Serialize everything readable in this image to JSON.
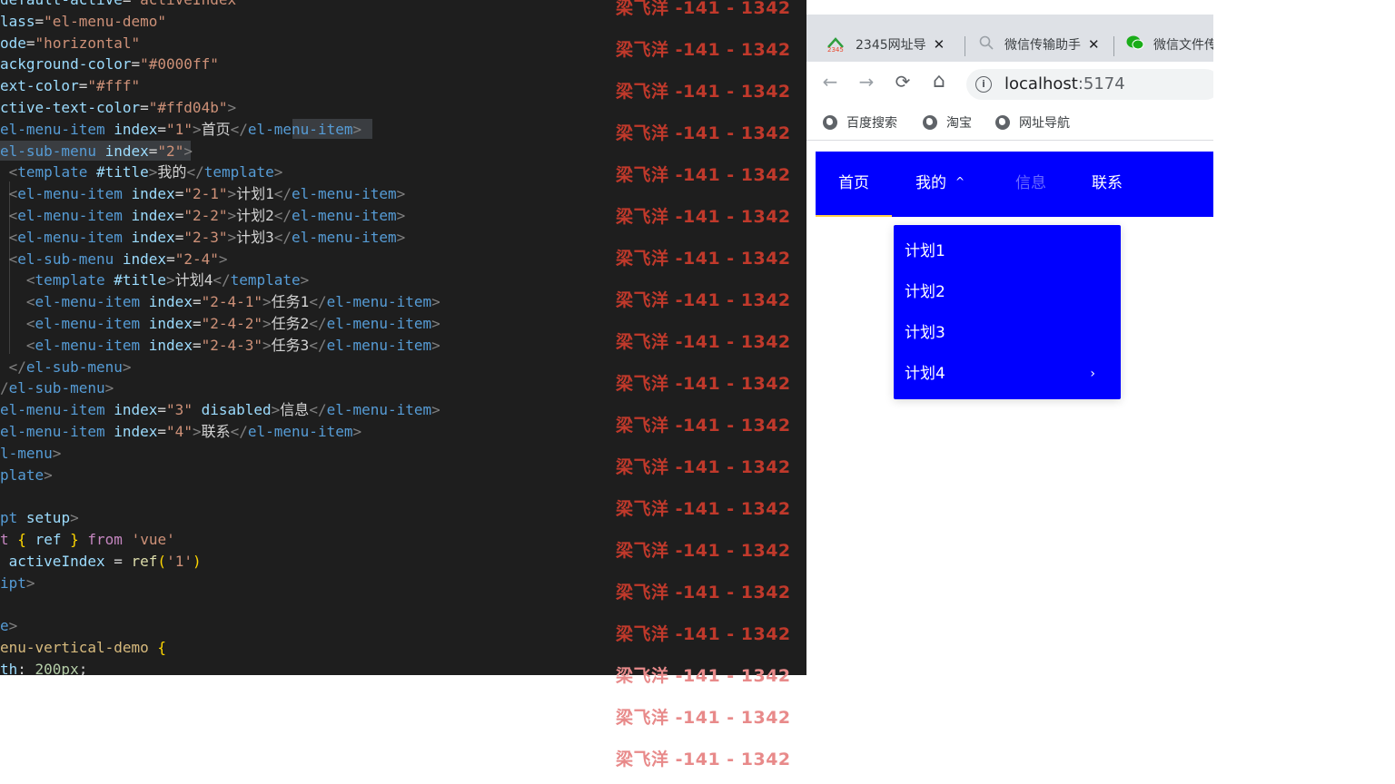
{
  "editor": {
    "lines": [
      [
        {
          "c": "t-attr",
          "t": "default-active"
        },
        {
          "c": "t-txt",
          "t": "="
        },
        {
          "c": "t-str",
          "t": "\"activeIndex\""
        }
      ],
      [
        {
          "c": "t-attr",
          "t": "lass"
        },
        {
          "c": "t-txt",
          "t": "="
        },
        {
          "c": "t-str",
          "t": "\"el-menu-demo\""
        }
      ],
      [
        {
          "c": "t-attr",
          "t": "ode"
        },
        {
          "c": "t-txt",
          "t": "="
        },
        {
          "c": "t-str",
          "t": "\"horizontal\""
        }
      ],
      [
        {
          "c": "t-attr",
          "t": "ackground-color"
        },
        {
          "c": "t-txt",
          "t": "="
        },
        {
          "c": "t-str",
          "t": "\"#0000ff\""
        }
      ],
      [
        {
          "c": "t-attr",
          "t": "ext-color"
        },
        {
          "c": "t-txt",
          "t": "="
        },
        {
          "c": "t-str",
          "t": "\"#fff\""
        }
      ],
      [
        {
          "c": "t-attr",
          "t": "ctive-text-color"
        },
        {
          "c": "t-txt",
          "t": "="
        },
        {
          "c": "t-str",
          "t": "\"#ffd04b\""
        },
        {
          "c": "t-br",
          "t": ">"
        }
      ],
      [
        {
          "c": "t-tag",
          "t": "el-menu-item"
        },
        {
          "c": "t-txt",
          "t": " "
        },
        {
          "c": "t-attr",
          "t": "index"
        },
        {
          "c": "t-txt",
          "t": "="
        },
        {
          "c": "t-str",
          "t": "\"1\""
        },
        {
          "c": "t-br",
          "t": ">"
        },
        {
          "c": "t-txt",
          "t": "首页"
        },
        {
          "c": "t-br",
          "t": "</"
        },
        {
          "c": "t-tag",
          "t": "el-menu-item"
        },
        {
          "c": "t-br",
          "t": ">"
        }
      ],
      [
        {
          "c": "t-tag",
          "t": "el-sub-menu"
        },
        {
          "c": "t-txt",
          "t": " "
        },
        {
          "c": "t-attr",
          "t": "index"
        },
        {
          "c": "t-txt",
          "t": "="
        },
        {
          "c": "t-str",
          "t": "\"2\""
        },
        {
          "c": "t-br",
          "t": ">"
        }
      ],
      [
        {
          "c": "t-txt",
          "t": " "
        },
        {
          "c": "t-br",
          "t": "<"
        },
        {
          "c": "t-tag",
          "t": "template"
        },
        {
          "c": "t-txt",
          "t": " "
        },
        {
          "c": "t-attr",
          "t": "#title"
        },
        {
          "c": "t-br",
          "t": ">"
        },
        {
          "c": "t-txt",
          "t": "我的"
        },
        {
          "c": "t-br",
          "t": "</"
        },
        {
          "c": "t-tag",
          "t": "template"
        },
        {
          "c": "t-br",
          "t": ">"
        }
      ],
      [
        {
          "c": "t-txt",
          "t": " "
        },
        {
          "c": "t-br",
          "t": "<"
        },
        {
          "c": "t-tag",
          "t": "el-menu-item"
        },
        {
          "c": "t-txt",
          "t": " "
        },
        {
          "c": "t-attr",
          "t": "index"
        },
        {
          "c": "t-txt",
          "t": "="
        },
        {
          "c": "t-str",
          "t": "\"2-1\""
        },
        {
          "c": "t-br",
          "t": ">"
        },
        {
          "c": "t-txt",
          "t": "计划1"
        },
        {
          "c": "t-br",
          "t": "</"
        },
        {
          "c": "t-tag",
          "t": "el-menu-item"
        },
        {
          "c": "t-br",
          "t": ">"
        }
      ],
      [
        {
          "c": "t-txt",
          "t": " "
        },
        {
          "c": "t-br",
          "t": "<"
        },
        {
          "c": "t-tag",
          "t": "el-menu-item"
        },
        {
          "c": "t-txt",
          "t": " "
        },
        {
          "c": "t-attr",
          "t": "index"
        },
        {
          "c": "t-txt",
          "t": "="
        },
        {
          "c": "t-str",
          "t": "\"2-2\""
        },
        {
          "c": "t-br",
          "t": ">"
        },
        {
          "c": "t-txt",
          "t": "计划2"
        },
        {
          "c": "t-br",
          "t": "</"
        },
        {
          "c": "t-tag",
          "t": "el-menu-item"
        },
        {
          "c": "t-br",
          "t": ">"
        }
      ],
      [
        {
          "c": "t-txt",
          "t": " "
        },
        {
          "c": "t-br",
          "t": "<"
        },
        {
          "c": "t-tag",
          "t": "el-menu-item"
        },
        {
          "c": "t-txt",
          "t": " "
        },
        {
          "c": "t-attr",
          "t": "index"
        },
        {
          "c": "t-txt",
          "t": "="
        },
        {
          "c": "t-str",
          "t": "\"2-3\""
        },
        {
          "c": "t-br",
          "t": ">"
        },
        {
          "c": "t-txt",
          "t": "计划3"
        },
        {
          "c": "t-br",
          "t": "</"
        },
        {
          "c": "t-tag",
          "t": "el-menu-item"
        },
        {
          "c": "t-br",
          "t": ">"
        }
      ],
      [
        {
          "c": "t-txt",
          "t": " "
        },
        {
          "c": "t-br",
          "t": "<"
        },
        {
          "c": "t-tag",
          "t": "el-sub-menu"
        },
        {
          "c": "t-txt",
          "t": " "
        },
        {
          "c": "t-attr",
          "t": "index"
        },
        {
          "c": "t-txt",
          "t": "="
        },
        {
          "c": "t-str",
          "t": "\"2-4\""
        },
        {
          "c": "t-br",
          "t": ">"
        }
      ],
      [
        {
          "c": "t-txt",
          "t": "   "
        },
        {
          "c": "t-br",
          "t": "<"
        },
        {
          "c": "t-tag",
          "t": "template"
        },
        {
          "c": "t-txt",
          "t": " "
        },
        {
          "c": "t-attr",
          "t": "#title"
        },
        {
          "c": "t-br",
          "t": ">"
        },
        {
          "c": "t-txt",
          "t": "计划4"
        },
        {
          "c": "t-br",
          "t": "</"
        },
        {
          "c": "t-tag",
          "t": "template"
        },
        {
          "c": "t-br",
          "t": ">"
        }
      ],
      [
        {
          "c": "t-txt",
          "t": "   "
        },
        {
          "c": "t-br",
          "t": "<"
        },
        {
          "c": "t-tag",
          "t": "el-menu-item"
        },
        {
          "c": "t-txt",
          "t": " "
        },
        {
          "c": "t-attr",
          "t": "index"
        },
        {
          "c": "t-txt",
          "t": "="
        },
        {
          "c": "t-str",
          "t": "\"2-4-1\""
        },
        {
          "c": "t-br",
          "t": ">"
        },
        {
          "c": "t-txt",
          "t": "任务1"
        },
        {
          "c": "t-br",
          "t": "</"
        },
        {
          "c": "t-tag",
          "t": "el-menu-item"
        },
        {
          "c": "t-br",
          "t": ">"
        }
      ],
      [
        {
          "c": "t-txt",
          "t": "   "
        },
        {
          "c": "t-br",
          "t": "<"
        },
        {
          "c": "t-tag",
          "t": "el-menu-item"
        },
        {
          "c": "t-txt",
          "t": " "
        },
        {
          "c": "t-attr",
          "t": "index"
        },
        {
          "c": "t-txt",
          "t": "="
        },
        {
          "c": "t-str",
          "t": "\"2-4-2\""
        },
        {
          "c": "t-br",
          "t": ">"
        },
        {
          "c": "t-txt",
          "t": "任务2"
        },
        {
          "c": "t-br",
          "t": "</"
        },
        {
          "c": "t-tag",
          "t": "el-menu-item"
        },
        {
          "c": "t-br",
          "t": ">"
        }
      ],
      [
        {
          "c": "t-txt",
          "t": "   "
        },
        {
          "c": "t-br",
          "t": "<"
        },
        {
          "c": "t-tag",
          "t": "el-menu-item"
        },
        {
          "c": "t-txt",
          "t": " "
        },
        {
          "c": "t-attr",
          "t": "index"
        },
        {
          "c": "t-txt",
          "t": "="
        },
        {
          "c": "t-str",
          "t": "\"2-4-3\""
        },
        {
          "c": "t-br",
          "t": ">"
        },
        {
          "c": "t-txt",
          "t": "任务3"
        },
        {
          "c": "t-br",
          "t": "</"
        },
        {
          "c": "t-tag",
          "t": "el-menu-item"
        },
        {
          "c": "t-br",
          "t": ">"
        }
      ],
      [
        {
          "c": "t-txt",
          "t": " "
        },
        {
          "c": "t-br",
          "t": "</"
        },
        {
          "c": "t-tag",
          "t": "el-sub-menu"
        },
        {
          "c": "t-br",
          "t": ">"
        }
      ],
      [
        {
          "c": "t-br",
          "t": "/"
        },
        {
          "c": "t-tag",
          "t": "el-sub-menu"
        },
        {
          "c": "t-br",
          "t": ">"
        }
      ],
      [
        {
          "c": "t-tag",
          "t": "el-menu-item"
        },
        {
          "c": "t-txt",
          "t": " "
        },
        {
          "c": "t-attr",
          "t": "index"
        },
        {
          "c": "t-txt",
          "t": "="
        },
        {
          "c": "t-str",
          "t": "\"3\""
        },
        {
          "c": "t-txt",
          "t": " "
        },
        {
          "c": "t-attr",
          "t": "disabled"
        },
        {
          "c": "t-br",
          "t": ">"
        },
        {
          "c": "t-txt",
          "t": "信息"
        },
        {
          "c": "t-br",
          "t": "</"
        },
        {
          "c": "t-tag",
          "t": "el-menu-item"
        },
        {
          "c": "t-br",
          "t": ">"
        }
      ],
      [
        {
          "c": "t-tag",
          "t": "el-menu-item"
        },
        {
          "c": "t-txt",
          "t": " "
        },
        {
          "c": "t-attr",
          "t": "index"
        },
        {
          "c": "t-txt",
          "t": "="
        },
        {
          "c": "t-str",
          "t": "\"4\""
        },
        {
          "c": "t-br",
          "t": ">"
        },
        {
          "c": "t-txt",
          "t": "联系"
        },
        {
          "c": "t-br",
          "t": "</"
        },
        {
          "c": "t-tag",
          "t": "el-menu-item"
        },
        {
          "c": "t-br",
          "t": ">"
        }
      ],
      [
        {
          "c": "t-tag",
          "t": "l-menu"
        },
        {
          "c": "t-br",
          "t": ">"
        }
      ],
      [
        {
          "c": "t-tag",
          "t": "plate"
        },
        {
          "c": "t-br",
          "t": ">"
        }
      ],
      [],
      [
        {
          "c": "t-tag",
          "t": "pt"
        },
        {
          "c": "t-txt",
          "t": " "
        },
        {
          "c": "t-attr",
          "t": "setup"
        },
        {
          "c": "t-br",
          "t": ">"
        }
      ],
      [
        {
          "c": "t-kw",
          "t": "t"
        },
        {
          "c": "t-txt",
          "t": " "
        },
        {
          "c": "t-paren",
          "t": "{"
        },
        {
          "c": "t-txt",
          "t": " "
        },
        {
          "c": "t-attr",
          "t": "ref"
        },
        {
          "c": "t-txt",
          "t": " "
        },
        {
          "c": "t-paren",
          "t": "}"
        },
        {
          "c": "t-txt",
          "t": " "
        },
        {
          "c": "t-kw",
          "t": "from"
        },
        {
          "c": "t-txt",
          "t": " "
        },
        {
          "c": "t-str",
          "t": "'vue'"
        }
      ],
      [
        {
          "c": "t-txt",
          "t": " "
        },
        {
          "c": "t-attr",
          "t": "activeIndex"
        },
        {
          "c": "t-txt",
          "t": " = "
        },
        {
          "c": "t-fn",
          "t": "ref"
        },
        {
          "c": "t-paren",
          "t": "("
        },
        {
          "c": "t-str",
          "t": "'1'"
        },
        {
          "c": "t-paren",
          "t": ")"
        }
      ],
      [
        {
          "c": "t-tag",
          "t": "ipt"
        },
        {
          "c": "t-br",
          "t": ">"
        }
      ],
      [],
      [
        {
          "c": "t-tag",
          "t": "e"
        },
        {
          "c": "t-br",
          "t": ">"
        }
      ],
      [
        {
          "c": "t-sel",
          "t": "enu-vertical-demo"
        },
        {
          "c": "t-txt",
          "t": " "
        },
        {
          "c": "t-paren",
          "t": "{"
        }
      ],
      [
        {
          "c": "t-attr",
          "t": "th"
        },
        {
          "c": "t-txt",
          "t": ": "
        },
        {
          "c": "t-num",
          "t": "200px"
        },
        {
          "c": "t-txt",
          "t": ";"
        }
      ]
    ]
  },
  "watermark": {
    "text": "梁飞洋 -141 - 1342",
    "count": 19
  },
  "browser": {
    "tabs": [
      {
        "label": "2345网址导",
        "close": "✕"
      },
      {
        "label": "微信传输助手",
        "close": "✕"
      },
      {
        "label": "微信文件传"
      }
    ],
    "nav": {
      "back": "←",
      "forward": "→",
      "reload": "⟳",
      "home": "⌂"
    },
    "omnibox": {
      "info": "i",
      "host": "localhost",
      "port": ":5174"
    },
    "bookmarks": [
      "百度搜索",
      "淘宝",
      "网址导航"
    ]
  },
  "menu": {
    "background": "#0000ff",
    "text_color": "#ffffff",
    "active_text_color": "#ffd04b",
    "items": [
      {
        "label": "首页"
      },
      {
        "label": "我的",
        "chevron": "^"
      },
      {
        "label": "信息"
      },
      {
        "label": "联系"
      }
    ],
    "submenu": [
      {
        "label": "计划1"
      },
      {
        "label": "计划2"
      },
      {
        "label": "计划3"
      },
      {
        "label": "计划4",
        "arrow": "›"
      }
    ]
  }
}
